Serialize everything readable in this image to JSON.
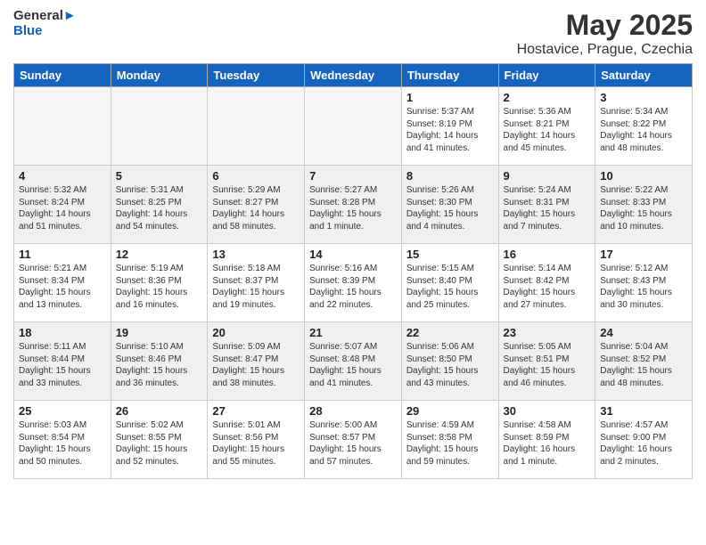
{
  "header": {
    "logo_line1": "General",
    "logo_line2": "Blue",
    "title": "May 2025",
    "subtitle": "Hostavice, Prague, Czechia"
  },
  "weekdays": [
    "Sunday",
    "Monday",
    "Tuesday",
    "Wednesday",
    "Thursday",
    "Friday",
    "Saturday"
  ],
  "weeks": [
    [
      {
        "day": "",
        "info": ""
      },
      {
        "day": "",
        "info": ""
      },
      {
        "day": "",
        "info": ""
      },
      {
        "day": "",
        "info": ""
      },
      {
        "day": "1",
        "info": "Sunrise: 5:37 AM\nSunset: 8:19 PM\nDaylight: 14 hours\nand 41 minutes."
      },
      {
        "day": "2",
        "info": "Sunrise: 5:36 AM\nSunset: 8:21 PM\nDaylight: 14 hours\nand 45 minutes."
      },
      {
        "day": "3",
        "info": "Sunrise: 5:34 AM\nSunset: 8:22 PM\nDaylight: 14 hours\nand 48 minutes."
      }
    ],
    [
      {
        "day": "4",
        "info": "Sunrise: 5:32 AM\nSunset: 8:24 PM\nDaylight: 14 hours\nand 51 minutes."
      },
      {
        "day": "5",
        "info": "Sunrise: 5:31 AM\nSunset: 8:25 PM\nDaylight: 14 hours\nand 54 minutes."
      },
      {
        "day": "6",
        "info": "Sunrise: 5:29 AM\nSunset: 8:27 PM\nDaylight: 14 hours\nand 58 minutes."
      },
      {
        "day": "7",
        "info": "Sunrise: 5:27 AM\nSunset: 8:28 PM\nDaylight: 15 hours\nand 1 minute."
      },
      {
        "day": "8",
        "info": "Sunrise: 5:26 AM\nSunset: 8:30 PM\nDaylight: 15 hours\nand 4 minutes."
      },
      {
        "day": "9",
        "info": "Sunrise: 5:24 AM\nSunset: 8:31 PM\nDaylight: 15 hours\nand 7 minutes."
      },
      {
        "day": "10",
        "info": "Sunrise: 5:22 AM\nSunset: 8:33 PM\nDaylight: 15 hours\nand 10 minutes."
      }
    ],
    [
      {
        "day": "11",
        "info": "Sunrise: 5:21 AM\nSunset: 8:34 PM\nDaylight: 15 hours\nand 13 minutes."
      },
      {
        "day": "12",
        "info": "Sunrise: 5:19 AM\nSunset: 8:36 PM\nDaylight: 15 hours\nand 16 minutes."
      },
      {
        "day": "13",
        "info": "Sunrise: 5:18 AM\nSunset: 8:37 PM\nDaylight: 15 hours\nand 19 minutes."
      },
      {
        "day": "14",
        "info": "Sunrise: 5:16 AM\nSunset: 8:39 PM\nDaylight: 15 hours\nand 22 minutes."
      },
      {
        "day": "15",
        "info": "Sunrise: 5:15 AM\nSunset: 8:40 PM\nDaylight: 15 hours\nand 25 minutes."
      },
      {
        "day": "16",
        "info": "Sunrise: 5:14 AM\nSunset: 8:42 PM\nDaylight: 15 hours\nand 27 minutes."
      },
      {
        "day": "17",
        "info": "Sunrise: 5:12 AM\nSunset: 8:43 PM\nDaylight: 15 hours\nand 30 minutes."
      }
    ],
    [
      {
        "day": "18",
        "info": "Sunrise: 5:11 AM\nSunset: 8:44 PM\nDaylight: 15 hours\nand 33 minutes."
      },
      {
        "day": "19",
        "info": "Sunrise: 5:10 AM\nSunset: 8:46 PM\nDaylight: 15 hours\nand 36 minutes."
      },
      {
        "day": "20",
        "info": "Sunrise: 5:09 AM\nSunset: 8:47 PM\nDaylight: 15 hours\nand 38 minutes."
      },
      {
        "day": "21",
        "info": "Sunrise: 5:07 AM\nSunset: 8:48 PM\nDaylight: 15 hours\nand 41 minutes."
      },
      {
        "day": "22",
        "info": "Sunrise: 5:06 AM\nSunset: 8:50 PM\nDaylight: 15 hours\nand 43 minutes."
      },
      {
        "day": "23",
        "info": "Sunrise: 5:05 AM\nSunset: 8:51 PM\nDaylight: 15 hours\nand 46 minutes."
      },
      {
        "day": "24",
        "info": "Sunrise: 5:04 AM\nSunset: 8:52 PM\nDaylight: 15 hours\nand 48 minutes."
      }
    ],
    [
      {
        "day": "25",
        "info": "Sunrise: 5:03 AM\nSunset: 8:54 PM\nDaylight: 15 hours\nand 50 minutes."
      },
      {
        "day": "26",
        "info": "Sunrise: 5:02 AM\nSunset: 8:55 PM\nDaylight: 15 hours\nand 52 minutes."
      },
      {
        "day": "27",
        "info": "Sunrise: 5:01 AM\nSunset: 8:56 PM\nDaylight: 15 hours\nand 55 minutes."
      },
      {
        "day": "28",
        "info": "Sunrise: 5:00 AM\nSunset: 8:57 PM\nDaylight: 15 hours\nand 57 minutes."
      },
      {
        "day": "29",
        "info": "Sunrise: 4:59 AM\nSunset: 8:58 PM\nDaylight: 15 hours\nand 59 minutes."
      },
      {
        "day": "30",
        "info": "Sunrise: 4:58 AM\nSunset: 8:59 PM\nDaylight: 16 hours\nand 1 minute."
      },
      {
        "day": "31",
        "info": "Sunrise: 4:57 AM\nSunset: 9:00 PM\nDaylight: 16 hours\nand 2 minutes."
      }
    ]
  ]
}
